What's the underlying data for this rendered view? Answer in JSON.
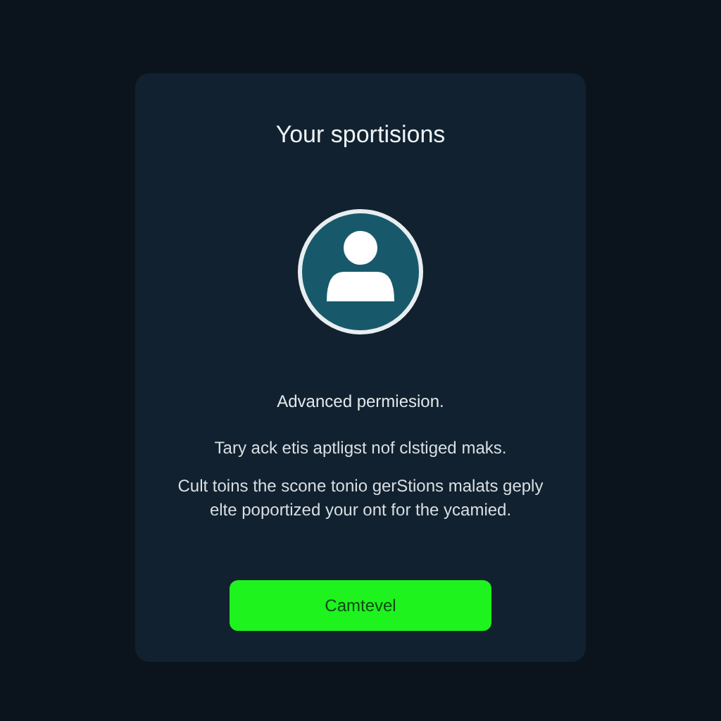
{
  "dialog": {
    "title": "Your sportisions",
    "subtitle": "Advanced permiesion.",
    "paragraphs": [
      "Tary ack etis aptligst nof clstiged maks.",
      "Cult toins the scone tonio gerStions malats geply elte poportized your ont for the ycamied."
    ],
    "button": "Camtevel"
  }
}
